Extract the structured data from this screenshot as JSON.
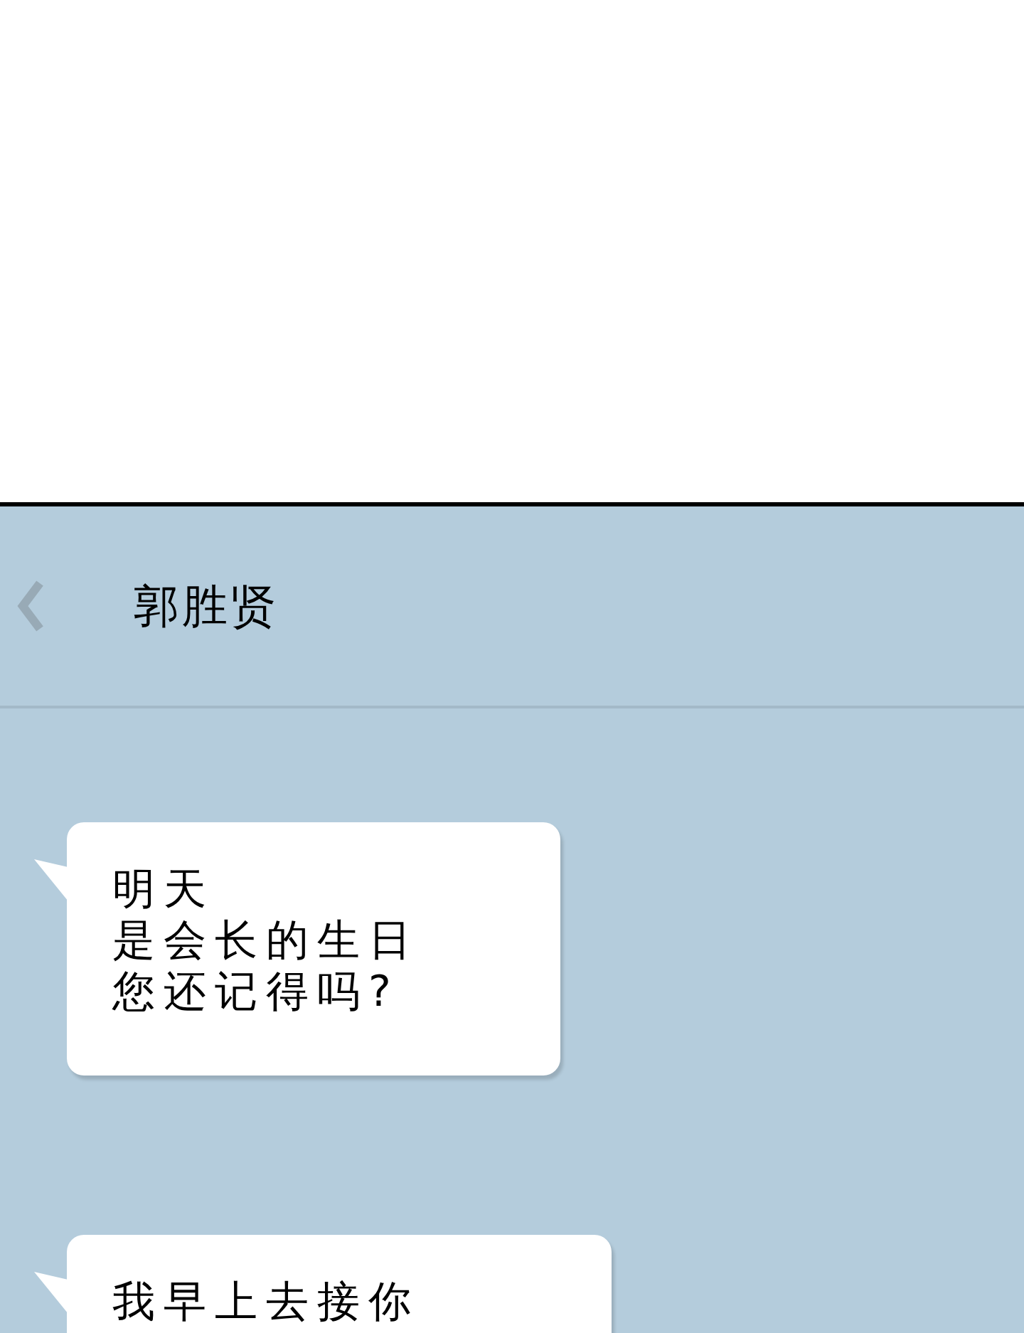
{
  "chat": {
    "contact_name": "郭胜贤"
  },
  "messages": [
    {
      "lines": [
        "明天",
        "是会长的生日",
        "您还记得吗?"
      ]
    },
    {
      "lines": [
        "我早上去接你"
      ]
    }
  ]
}
